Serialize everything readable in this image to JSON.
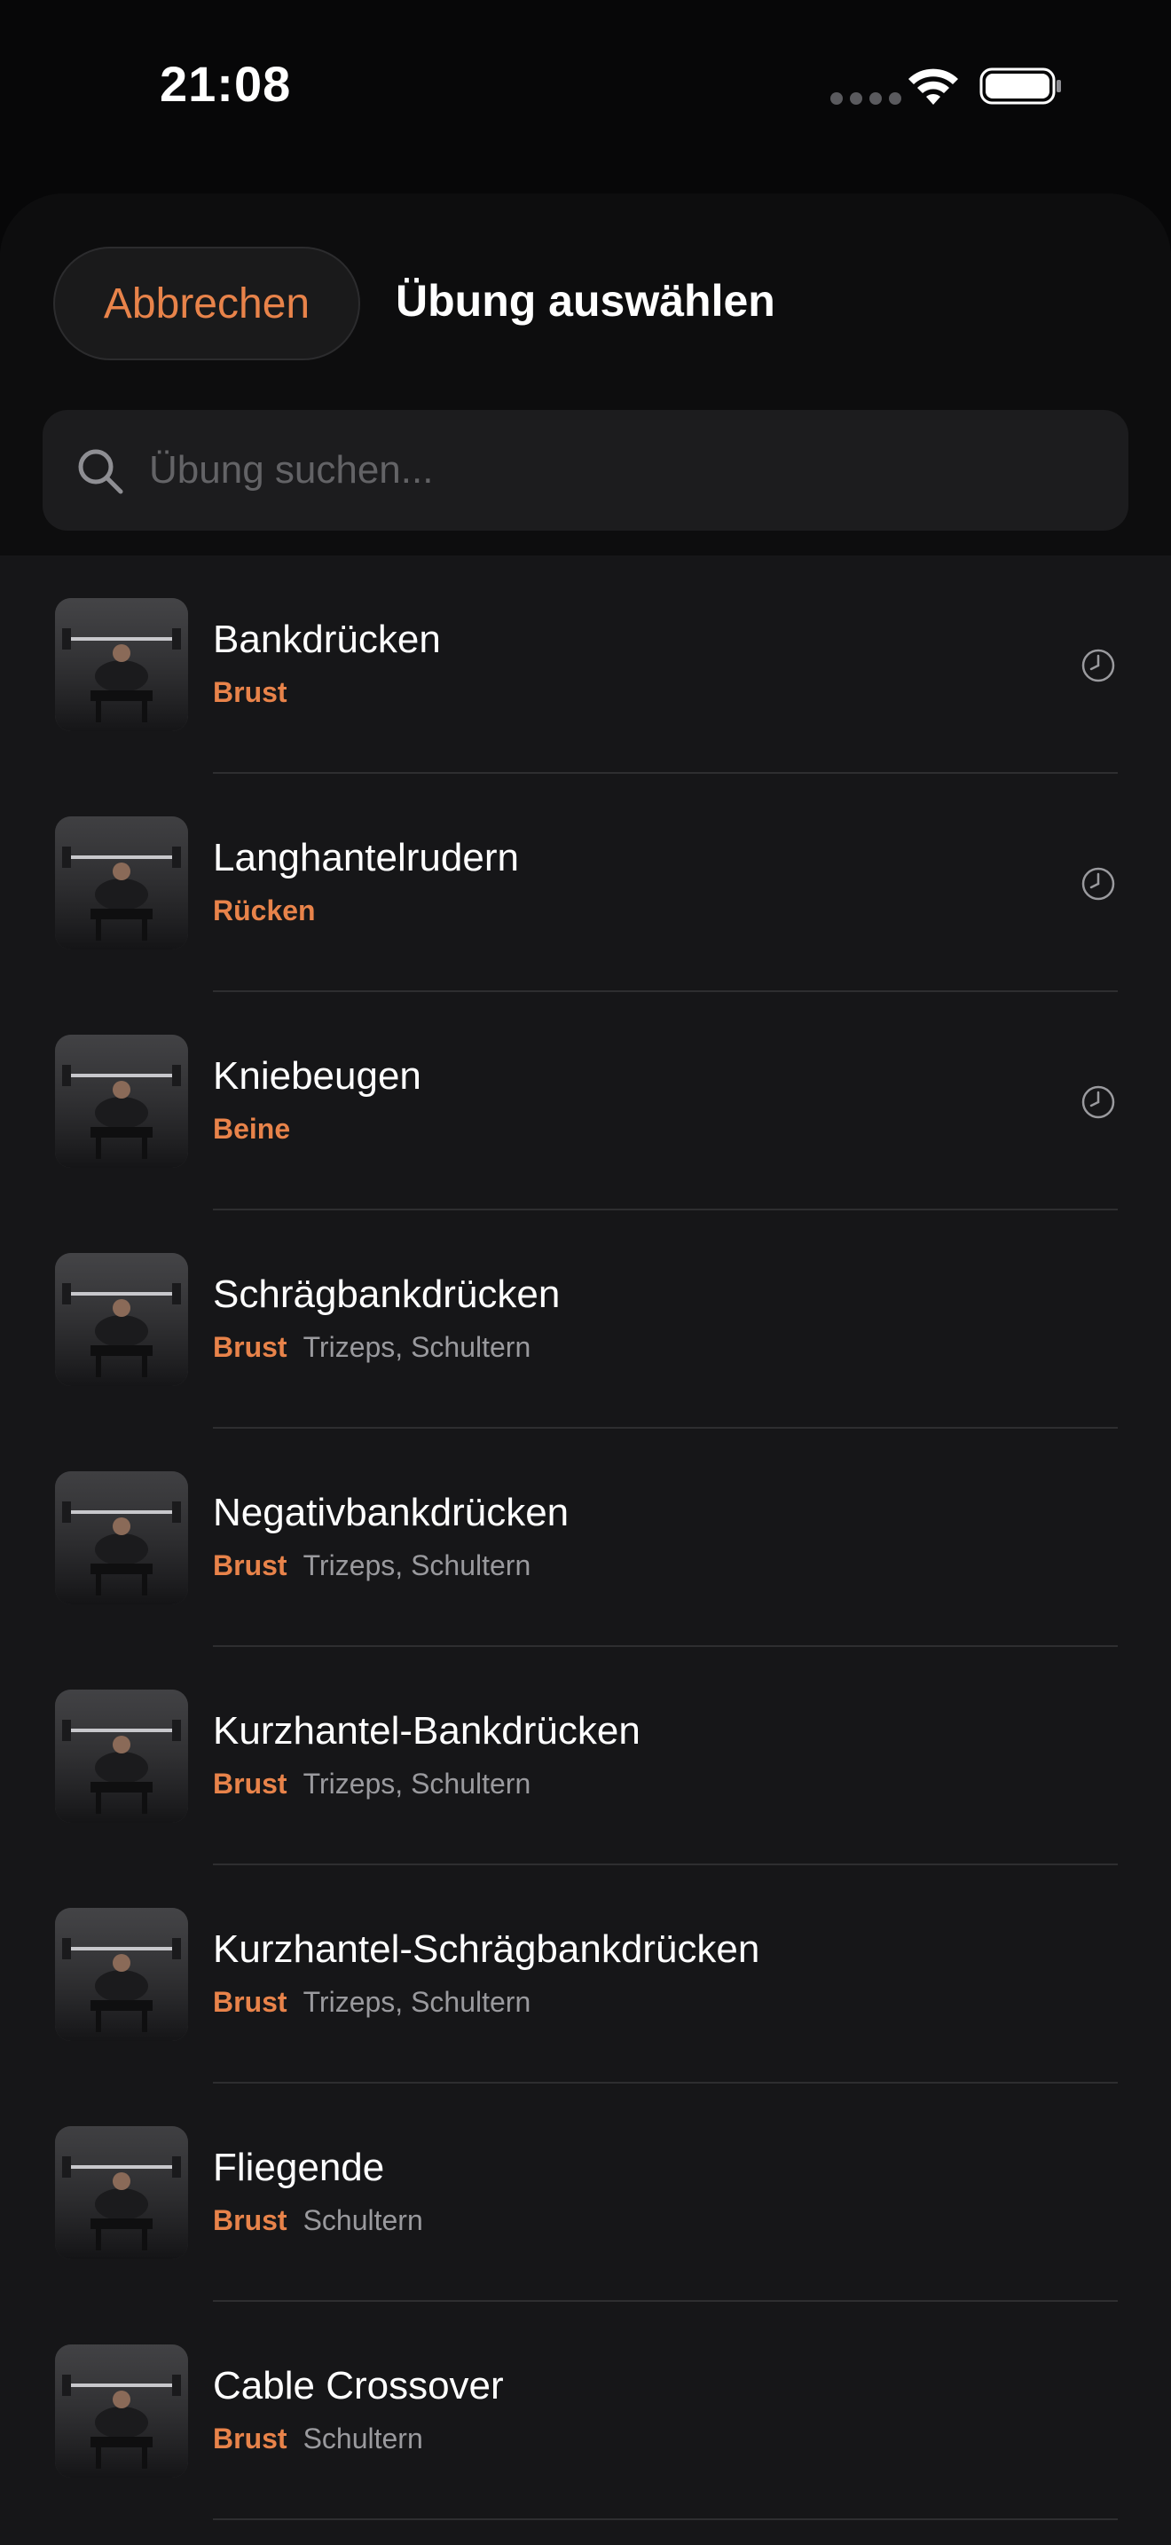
{
  "status_bar": {
    "time": "21:08"
  },
  "header": {
    "cancel_label": "Abbrechen",
    "title": "Übung auswählen"
  },
  "search": {
    "placeholder": "Übung suchen..."
  },
  "colors": {
    "accent": "#e8834a",
    "background": "#161618",
    "secondary_text": "#9a9a9e"
  },
  "exercises": [
    {
      "name": "Bankdrücken",
      "primary": "Brust",
      "secondary": "",
      "recent": true,
      "icon": "history-icon"
    },
    {
      "name": "Langhantelrudern",
      "primary": "Rücken",
      "secondary": "",
      "recent": true,
      "icon": "history-icon"
    },
    {
      "name": "Kniebeugen",
      "primary": "Beine",
      "secondary": "",
      "recent": true,
      "icon": "history-icon"
    },
    {
      "name": "Schrägbankdrücken",
      "primary": "Brust",
      "secondary": "Trizeps, Schultern",
      "recent": false
    },
    {
      "name": "Negativbankdrücken",
      "primary": "Brust",
      "secondary": "Trizeps, Schultern",
      "recent": false
    },
    {
      "name": "Kurzhantel-Bankdrücken",
      "primary": "Brust",
      "secondary": "Trizeps, Schultern",
      "recent": false
    },
    {
      "name": "Kurzhantel-Schrägbankdrücken",
      "primary": "Brust",
      "secondary": "Trizeps, Schultern",
      "recent": false
    },
    {
      "name": "Fliegende",
      "primary": "Brust",
      "secondary": "Schultern",
      "recent": false
    },
    {
      "name": "Cable Crossover",
      "primary": "Brust",
      "secondary": "Schultern",
      "recent": false
    }
  ]
}
